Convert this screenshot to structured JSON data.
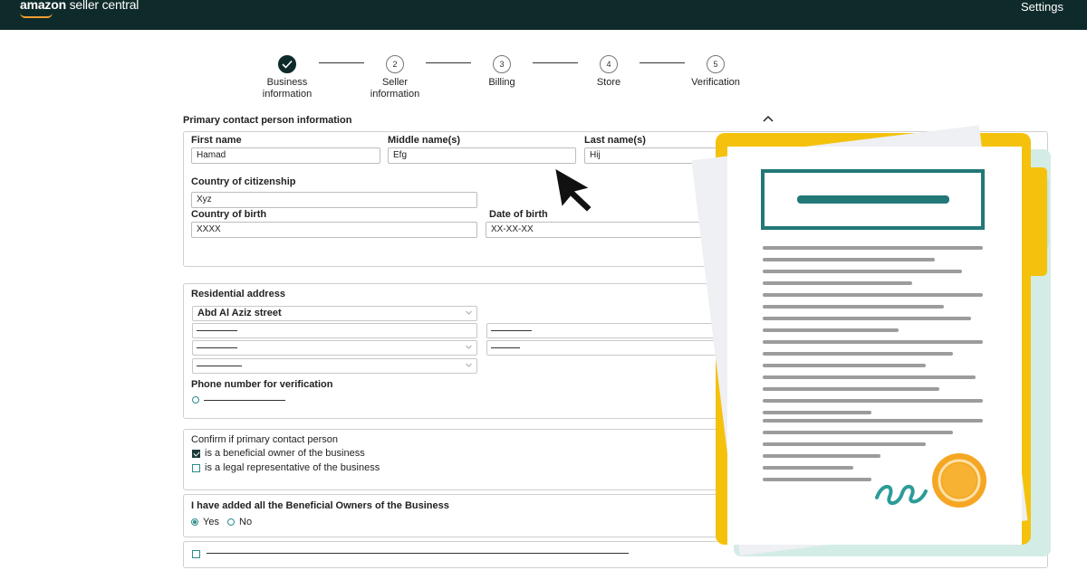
{
  "header": {
    "logo_bold": "amazon",
    "logo_rest": " seller central",
    "settings_label": "Settings"
  },
  "stepper": {
    "steps": [
      {
        "number": "",
        "label1": "Business",
        "label2": "information",
        "state": "done"
      },
      {
        "number": "2",
        "label1": "Seller",
        "label2": "information",
        "state": "pending"
      },
      {
        "number": "3",
        "label1": "Billing",
        "label2": "",
        "state": "pending"
      },
      {
        "number": "4",
        "label1": "Store",
        "label2": "",
        "state": "pending"
      },
      {
        "number": "5",
        "label1": "Verification",
        "label2": "",
        "state": "pending"
      }
    ]
  },
  "form": {
    "section_title": "Primary contact person information",
    "first_name_label": "First name",
    "first_name_value": "Hamad",
    "middle_name_label": "Middle name(s)",
    "middle_name_value": "Efg",
    "last_name_label": "Last name(s)",
    "last_name_value": "Hij",
    "citizenship_label": "Country of citizenship",
    "citizenship_value": "Xyz",
    "birth_country_label": "Country of birth",
    "birth_country_value": "XXXX",
    "dob_label": "Date of birth",
    "dob_value": "XX-XX-XX",
    "address_label": "Residential address",
    "address_line1": "Abd Al Aziz street",
    "phone_label": "Phone number for verification",
    "confirm_label": "Confirm if primary contact person",
    "confirm_opt1": "is a beneficial owner of the business",
    "confirm_opt2": "is a legal representative of the business",
    "owners_label": "I have added all the Beneficial Owners of the Business",
    "yes_label": "Yes",
    "no_label": "No"
  },
  "colors": {
    "topbar": "#0f2a2a",
    "accent_teal": "#2b8c8c",
    "folder_yellow": "#f4c20d",
    "seal_orange": "#f5a623"
  },
  "icons": [
    "check-icon",
    "chevron-up-icon",
    "chevron-down-icon",
    "cursor-arrow-icon",
    "certificate-document-illustration"
  ]
}
